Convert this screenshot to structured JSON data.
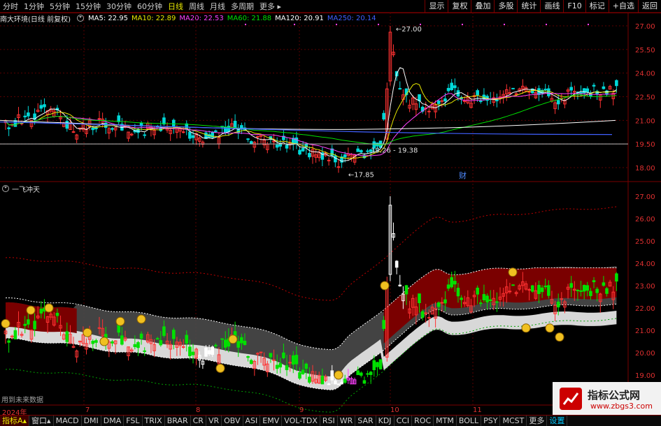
{
  "top_menu": {
    "periods": [
      "分时",
      "1分钟",
      "5分钟",
      "15分钟",
      "30分钟",
      "60分钟",
      "日线",
      "周线",
      "月线",
      "多周期",
      "更多"
    ],
    "active_period": "日线",
    "buttons": [
      "显示",
      "复权",
      "叠加",
      "多股",
      "统计",
      "画线",
      "F10",
      "标记",
      "+自选",
      "返回"
    ]
  },
  "main_chart": {
    "stock_title": "南大环境(日线 前复权)",
    "ma_labels": [
      {
        "text": "MA5: 22.95",
        "color": "#ffffff"
      },
      {
        "text": "MA10: 22.89",
        "color": "#e8e800"
      },
      {
        "text": "MA20: 22.53",
        "color": "#ff40ff"
      },
      {
        "text": "MA60: 21.88",
        "color": "#00e000"
      },
      {
        "text": "MA120: 20.91",
        "color": "#ffffff"
      },
      {
        "text": "MA250: 20.14",
        "color": "#4060ff"
      }
    ],
    "y_ticks": [
      "27.00",
      "25.50",
      "24.00",
      "22.50",
      "21.00",
      "19.50",
      "18.00"
    ],
    "annotations": {
      "high": "27.00",
      "low": "17.85",
      "range": "19.26 - 19.38",
      "marker": "财"
    }
  },
  "sub_chart": {
    "title": "一飞冲天",
    "y_ticks": [
      "27.00",
      "26.00",
      "25.00",
      "24.00",
      "23.00",
      "22.00",
      "21.00",
      "20.00",
      "19.00"
    ],
    "footnote": "用到未来数据"
  },
  "date_axis": {
    "labels": [
      "2024年",
      "7",
      "8",
      "9",
      "10",
      "11"
    ]
  },
  "indicator_tabs": {
    "items": [
      "指标A",
      "窗口",
      "MACD",
      "DMI",
      "DMA",
      "FSL",
      "TRIX",
      "BRAR",
      "CR",
      "VR",
      "OBV",
      "ASI",
      "EMV",
      "VOL-TDX",
      "RSI",
      "WR",
      "SAR",
      "KDJ",
      "CCI",
      "ROC",
      "MTM",
      "BOLL",
      "PSY",
      "MCST",
      "更多",
      "设置"
    ],
    "active": "指标A"
  },
  "watermark": {
    "title": "指标公式网",
    "url": "www.zbgs3.com"
  },
  "colors": {
    "up": "#ff3232",
    "down": "#00d8d8",
    "grid": "#8b0000",
    "axis": "#e03030"
  }
}
